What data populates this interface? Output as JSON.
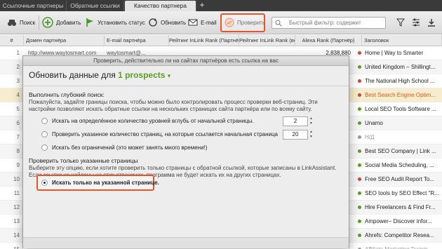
{
  "tabs": [
    {
      "label": "Ссылочные партнеры"
    },
    {
      "label": "Обратные ссылки"
    },
    {
      "label": "Качество партнера"
    }
  ],
  "toolbar": {
    "search_label": "Поиск",
    "add_label": "Добавить",
    "status_label": "Установить статус",
    "refresh_label": "Обновить",
    "email_label": "E-mail",
    "verify_label": "Проверить",
    "filter_placeholder": "Быстрый фильтр: содержит"
  },
  "columns": [
    "#",
    "Домен партнёра",
    "E-mail партнёра",
    "Рейтинг InLink Rank (Партнёр)",
    "Рейтинг InLink Rank (ве",
    "Alexa Rank (Партнёр)",
    "Заголовок"
  ],
  "rows": [
    {
      "n": "1",
      "url": "http://www.waytosmart.com",
      "email": "waytosmart@...",
      "alexa": "2,838,880",
      "dot": "#d9442b",
      "title": "Home | Way to Smarter",
      "style": ""
    },
    {
      "n": "2",
      "alexa": "",
      "dot": "#5aa021",
      "title": "United Kingdom – Shillingt...",
      "style": ""
    },
    {
      "n": "3",
      "alexa": "",
      "dot": "#d9442b",
      "title": "The National High School ...",
      "style": ""
    },
    {
      "n": "4",
      "alexa": "",
      "dot": "#d9442b",
      "title": "Best Search Engine Optim...",
      "style": "orange"
    },
    {
      "n": "5",
      "alexa": "",
      "dot": "#5aa021",
      "title": "Local SEO Tools Software ...",
      "style": ""
    },
    {
      "n": "6",
      "alexa": "",
      "dot": "#5aa021",
      "title": "Unamo",
      "style": ""
    },
    {
      "n": "7",
      "alexa": "",
      "dot": "#999999",
      "title": "Н/Д",
      "style": "gray"
    },
    {
      "n": "8",
      "alexa": "",
      "dot": "#5aa021",
      "title": "Best SEO Company | Link ...",
      "style": ""
    },
    {
      "n": "9",
      "alexa": "",
      "dot": "#5aa021",
      "title": "Social Media Scheduling, ...",
      "style": ""
    },
    {
      "n": "10",
      "alexa": "",
      "dot": "#d9442b",
      "title": "Free SEO Audit Report To...",
      "style": ""
    },
    {
      "n": "11",
      "alexa": "",
      "dot": "#5aa021",
      "title": "SEO tools by SEO Effect \"R...",
      "style": ""
    },
    {
      "n": "12",
      "alexa": "",
      "dot": "#5aa021",
      "title": "Hire Freelancers & Find Fr...",
      "style": ""
    },
    {
      "n": "13",
      "alexa": "",
      "dot": "#5aa021",
      "title": "Ampower– Discover infor...",
      "style": ""
    },
    {
      "n": "14",
      "alexa": "",
      "dot": "#5aa021",
      "title": "Ahrefs: Competitor Resea...",
      "style": ""
    },
    {
      "n": "15",
      "alexa": "",
      "dot": "#999999",
      "title": "Affiliate Marketing Trainin...",
      "style": "gray"
    }
  ],
  "dialog": {
    "window_title": "Проверить, действительно ли на сайтах партнёров есть ссылка на вас",
    "heading_prefix": "Обновить данные для",
    "heading_count": "1 prospects",
    "deep_title": "Выполнить глубокий поиск:",
    "deep_desc": "Пожалуйста, задайте границы поиска, чтобы можно было контролировать процесс проверки веб-страниц. Эти настройки позволяют искать обратные ссылки на нескольких страницах сайта партнёра или по всему сайту.",
    "opt1": "Искать на определённое количество уровней вглубь от начальной страницы.",
    "opt1_value": "2",
    "opt2": "Проверить указанное количество страниц, на которые ссылается начальная страница",
    "opt2_value": "20",
    "opt3": "Искать без ограничений (это может занять много времени!)",
    "only_title": "Проверить только указанные страницы",
    "only_desc": "Выберите эту опцию, если хотите проверить только страницы с обратной ссылкой, которые записаны в LinkAssistant. Если ссылки не найдены на этих страницах, программа не будет искать их на других страницах.",
    "opt4": "Искать только на указанной странице."
  },
  "colors": {
    "accent": "#e8542a",
    "brand_green": "#5aa021"
  }
}
